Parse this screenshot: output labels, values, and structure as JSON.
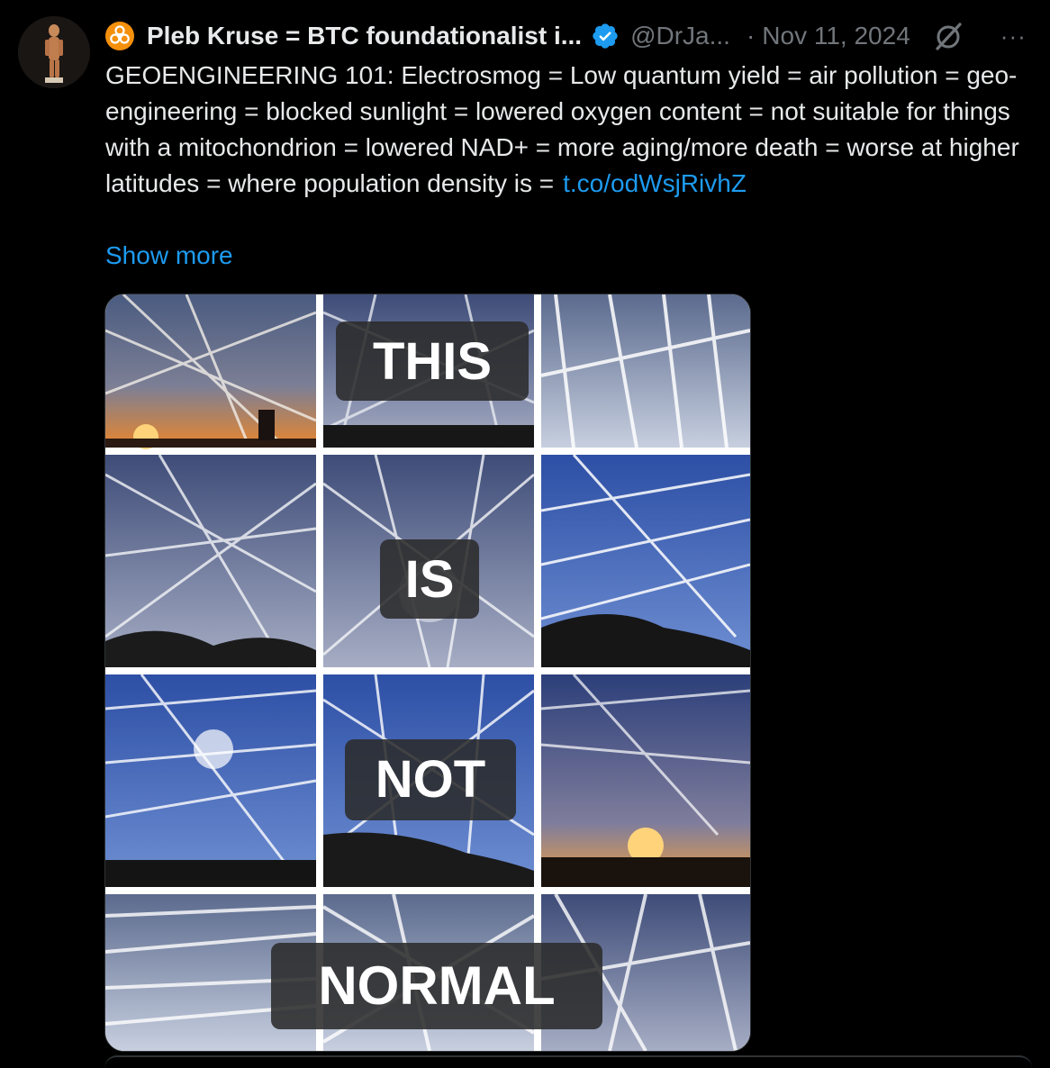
{
  "author": {
    "display_name": "Pleb Kruse = BTC foundationalist i...",
    "handle": "@DrJa...",
    "date_separator": "·",
    "date": "Nov 11, 2024",
    "more_glyph": "···"
  },
  "tweet": {
    "text": "GEOENGINEERING 101:  Electrosmog = Low quantum yield = air pollution = geo-engineering = blocked sunlight = lowered oxygen content = not suitable for things with a mitochondrion = lowered NAD+ = more aging/more death = worse at higher latitudes = where population density is =",
    "link": "t.co/odWsjRivhZ",
    "show_more": "Show more"
  },
  "media": {
    "words": [
      "THIS",
      "IS",
      "NOT",
      "NORMAL"
    ]
  },
  "colors": {
    "accent": "#1d9bf0",
    "muted": "#71767b",
    "text": "#e7e9ea",
    "biohazard": "#f4900c"
  }
}
